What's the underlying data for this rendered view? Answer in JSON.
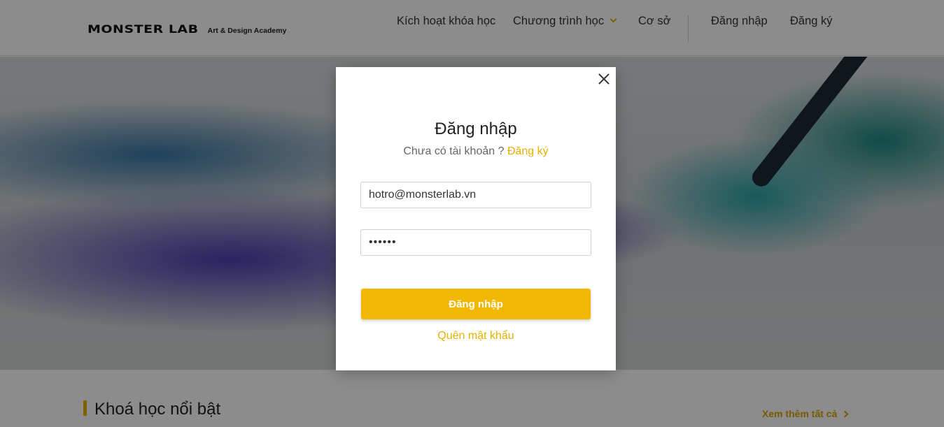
{
  "header": {
    "logo_text": "MONSTER LAB",
    "logo_tagline": "Art & Design Academy",
    "nav": {
      "activate_course": "Kích hoạt khóa học",
      "programs": "Chương trình học",
      "campus": "Cơ sở",
      "login": "Đăng nhập",
      "register": "Đăng ký"
    }
  },
  "section": {
    "title": "Khoá học nổi bật",
    "see_all": "Xem thêm tất cả"
  },
  "modal": {
    "title": "Đăng nhập",
    "subtitle_prefix": "Chưa có tài khoản ?",
    "subtitle_link": "Đăng ký",
    "email_value": "hotro@monsterlab.vn",
    "password_value": "••••••",
    "submit_label": "Đăng nhập",
    "forgot_label": "Quên mật khẩu"
  },
  "colors": {
    "accent": "#f2b705",
    "link": "#e6b000"
  },
  "icons": {
    "close": "close-icon",
    "nav_dropdown": "chevron-down-icon",
    "see_all": "chevron-right-icon"
  }
}
